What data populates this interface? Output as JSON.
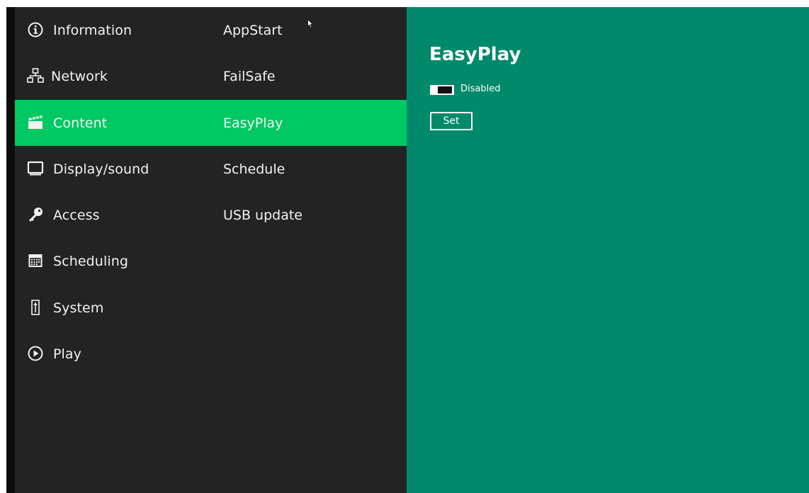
{
  "menu": {
    "items": [
      {
        "label": "Information",
        "icon": "info-icon"
      },
      {
        "label": "Network",
        "icon": "network-icon"
      },
      {
        "label": "Content",
        "icon": "clapperboard-icon",
        "selected": true
      },
      {
        "label": "Display/sound",
        "icon": "monitor-icon"
      },
      {
        "label": "Access",
        "icon": "key-icon"
      },
      {
        "label": "Scheduling",
        "icon": "calendar-icon"
      },
      {
        "label": "System",
        "icon": "system-icon"
      },
      {
        "label": "Play",
        "icon": "play-icon"
      }
    ]
  },
  "submenu": {
    "items": [
      {
        "label": "AppStart"
      },
      {
        "label": "FailSafe"
      },
      {
        "label": "EasyPlay",
        "selected": true
      },
      {
        "label": "Schedule"
      },
      {
        "label": "USB update"
      }
    ]
  },
  "detail": {
    "title": "EasyPlay",
    "toggle_label": "Disabled",
    "toggle_state": "off",
    "set_label": "Set"
  },
  "colors": {
    "sidebar_bg": "#232323",
    "selected_bg": "#00c963",
    "detail_bg": "#00896a",
    "text": "#f2f2f2"
  }
}
